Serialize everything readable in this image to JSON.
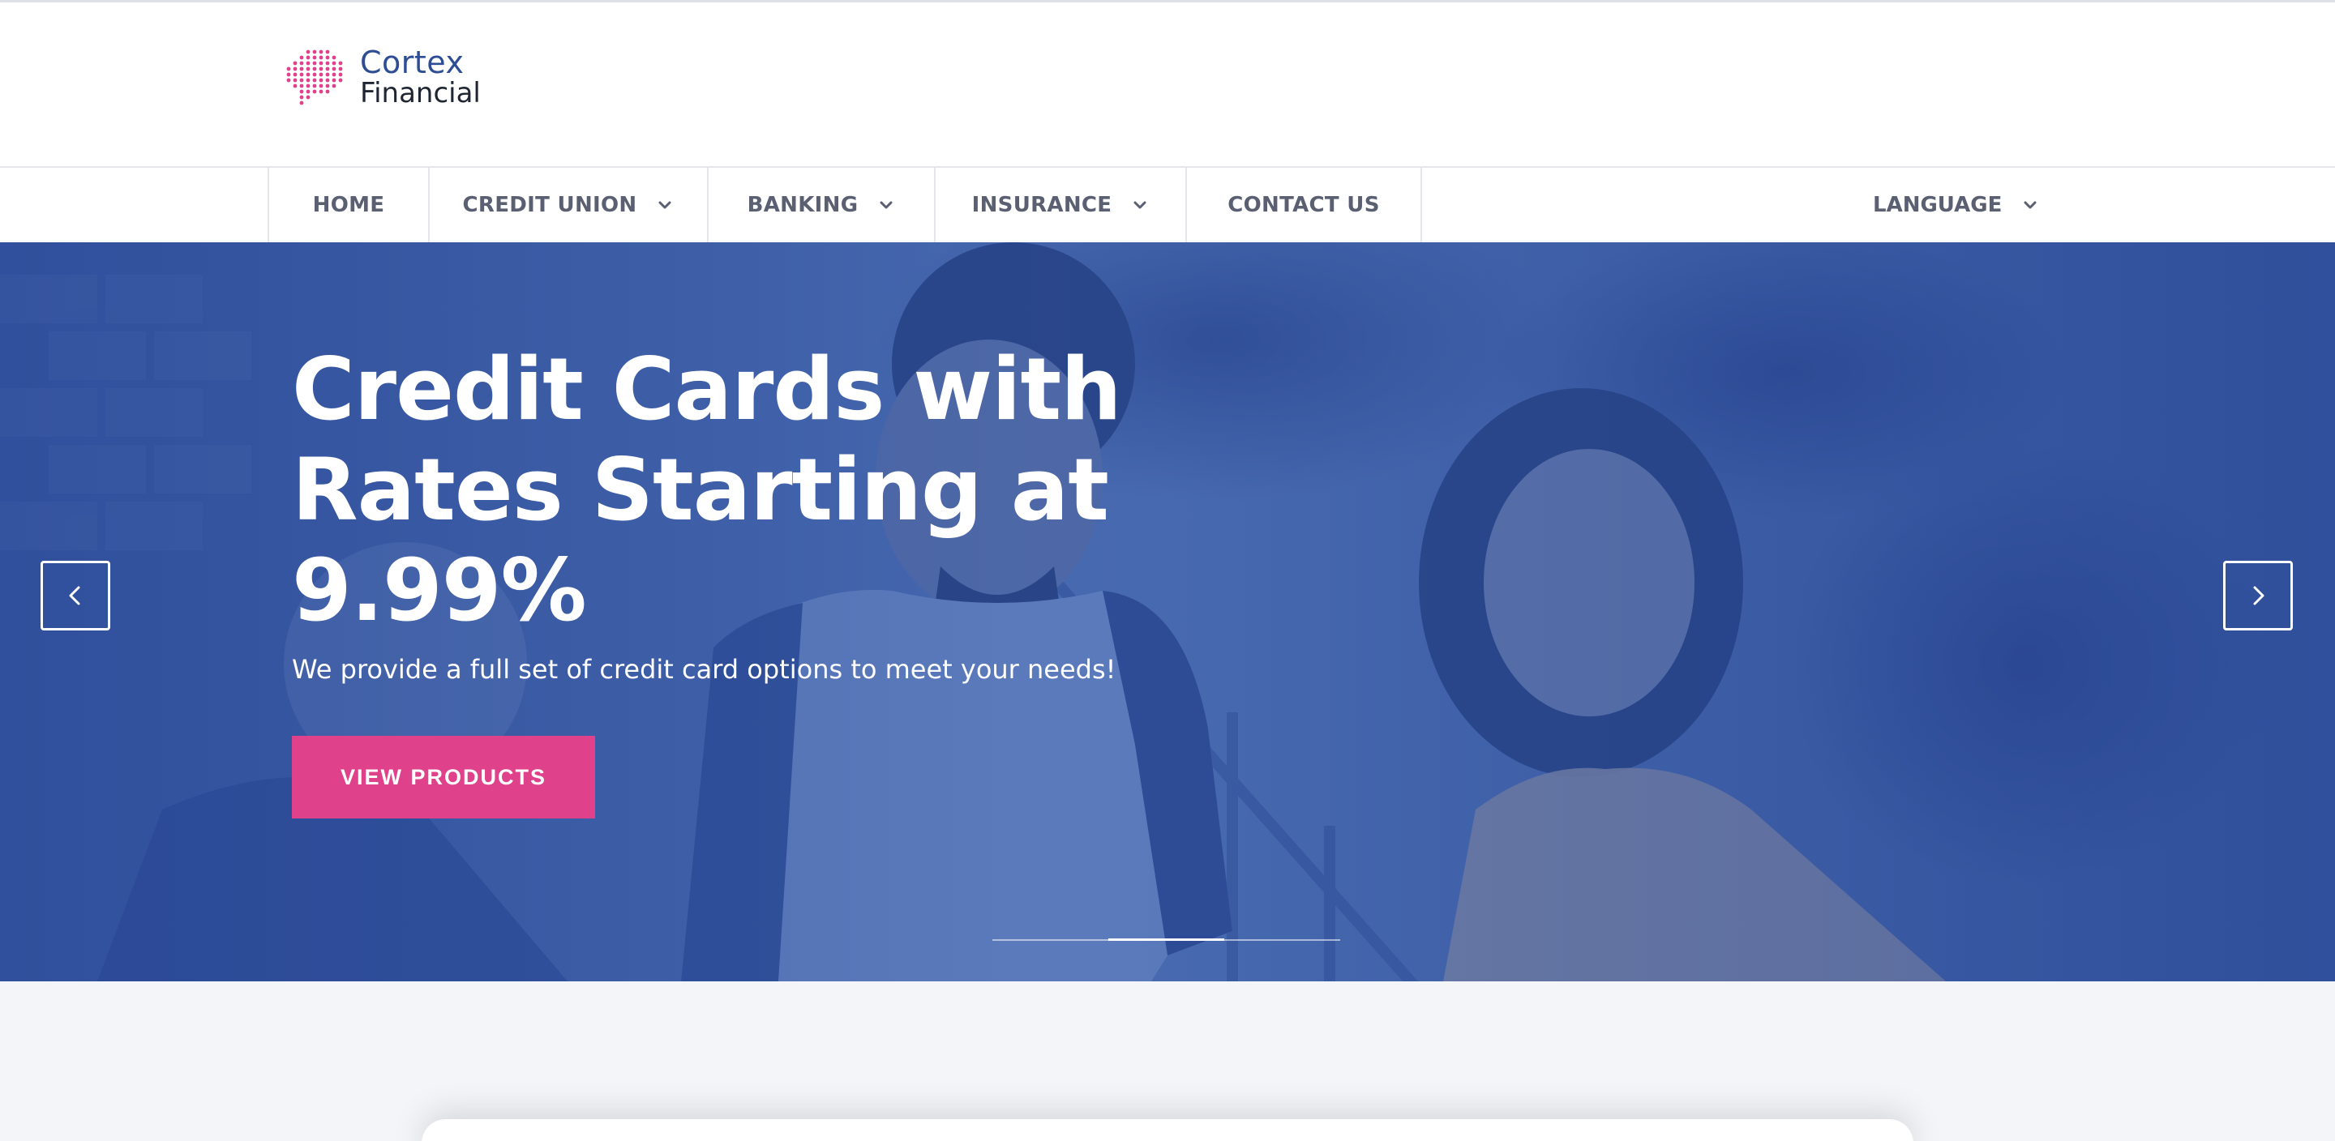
{
  "brand": {
    "line1": "Cortex",
    "line2": "Financial",
    "accent": "#e0418b",
    "primary": "#2d4e95"
  },
  "nav": {
    "items": [
      {
        "label": "HOME",
        "dropdown": false
      },
      {
        "label": "CREDIT UNION",
        "dropdown": true
      },
      {
        "label": "BANKING",
        "dropdown": true
      },
      {
        "label": "INSURANCE",
        "dropdown": true
      },
      {
        "label": "CONTACT US",
        "dropdown": false
      }
    ],
    "language_label": "LANGUAGE"
  },
  "hero": {
    "title": "Credit Cards with Rates Starting at 9.99%",
    "subtitle": "We provide a full set of credit card options to meet your needs!",
    "button_label": "VIEW PRODUCTS",
    "prev_icon": "chevron-left-icon",
    "next_icon": "chevron-right-icon",
    "slides_total": 3,
    "active_slide": 2
  }
}
